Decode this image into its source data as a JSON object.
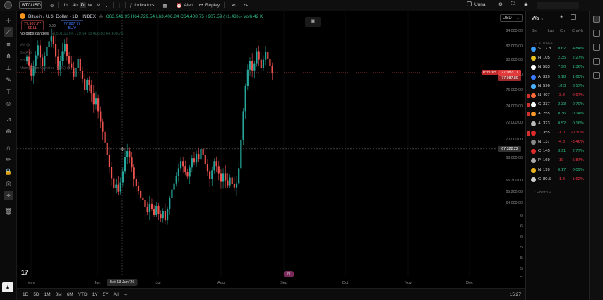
{
  "toolbar": {
    "symbol": "BTCUSD",
    "intervals": [
      "1h",
      "4h",
      "D",
      "W",
      "M"
    ],
    "active_interval": "D",
    "indicators_label": "Indicators",
    "alert_label": "Alert",
    "replay_label": "Replay",
    "layout_name": "Unna"
  },
  "legend": {
    "title": "Bitcoin / U.S. Dollar · 1D · INDEX",
    "ohlc": "O63,541.95 H64,729.54 L63,406.84 C64,408.75 +907.59 (+1.43%) Vol6.42 K",
    "sell_price": "77,987.77",
    "sell_label": "SELL",
    "mid_value": "0.00",
    "buy_price": "77,987.77",
    "buy_label": "BUY",
    "gaps_label": "No gaps candles",
    "gaps_values": "63,501.10 64,729.54 63,406.80 64,408.75",
    "ind_1": "Vol",
    "ind_2": "SMA",
    "ind_3": "BB",
    "ind_4": "Momentum Candles (1.00)"
  },
  "price_axis": {
    "currency": "USD",
    "ticks": [
      "84,000.00",
      "82,000.00",
      "80,000.00",
      "78,000.00",
      "76,000.00",
      "74,000.00",
      "72,000.00",
      "70,000.00",
      "68,000.00",
      "66,300.00",
      "65,200.00",
      "64,000.00",
      "6",
      "6",
      "6",
      "5",
      "5",
      "5",
      "5",
      "5"
    ],
    "current_price": "77,987.77",
    "current_sub": "77,987.89",
    "crosshair_price": "67,322.22",
    "symbol_tag": "BTCUSD"
  },
  "time_axis": {
    "ticks": [
      "May",
      "Jun",
      "Jul",
      "Aug",
      "Sep",
      "Oct",
      "Nov",
      "Dec"
    ],
    "hover_date": "Sat 13 Jun '26"
  },
  "ranges": [
    "1D",
    "5D",
    "1M",
    "3M",
    "6M",
    "YTD",
    "1Y",
    "5Y",
    "All"
  ],
  "clock": "15:27",
  "watchlist": {
    "title": "Wa",
    "columns": {
      "symbol": "Syr",
      "last": "Las",
      "change": "Ch",
      "change_pct": "Chg%"
    },
    "section_stocks": "STOCKS",
    "section_crypto": "CRYPTO",
    "rows": [
      {
        "sym": "S",
        "last": "17.8",
        "ch": "0.62",
        "pct": "4.84%",
        "dir": "up",
        "marker": false,
        "icon_color": "#3aa0ff"
      },
      {
        "sym": "H",
        "last": "105",
        "ch": "2.35",
        "pct": "2.27%",
        "dir": "up",
        "marker": false,
        "icon_color": "#e8c020"
      },
      {
        "sym": "N",
        "last": "583",
        "ch": "7.90",
        "pct": "1.36%",
        "dir": "up",
        "marker": false,
        "icon_color": "#ffffff"
      },
      {
        "sym": "A",
        "last": "329",
        "ch": "5.18",
        "pct": "1.60%",
        "dir": "up",
        "marker": false,
        "icon_color": "#3a7bff"
      },
      {
        "sym": "N",
        "last": "596",
        "ch": "18.3",
        "pct": "3.17%",
        "dir": "up",
        "marker": false,
        "icon_color": "#4ab0ff"
      },
      {
        "sym": "N",
        "last": "497",
        "ch": "-3.3",
        "pct": "-0.67%",
        "dir": "dn",
        "marker": true,
        "icon_color": "#ff6a3a"
      },
      {
        "sym": "G",
        "last": "337",
        "ch": "2.33",
        "pct": "0.70%",
        "dir": "up",
        "marker": true,
        "icon_color": "#ffffff"
      },
      {
        "sym": "A",
        "last": "255",
        "ch": "0.36",
        "pct": "0.14%",
        "dir": "up",
        "marker": true,
        "icon_color": "#ff9a2a"
      },
      {
        "sym": "A",
        "last": "323",
        "ch": "0.52",
        "pct": "0.16%",
        "dir": "up",
        "marker": false,
        "icon_color": "#bbbbbb"
      },
      {
        "sym": "T",
        "last": "355",
        "ch": "-1.0",
        "pct": "-0.30%",
        "dir": "dn",
        "marker": true,
        "icon_color": "#e02a2a"
      },
      {
        "sym": "N",
        "last": "137",
        "ch": "-4.8",
        "pct": "-3.46%",
        "dir": "dn",
        "marker": false,
        "icon_color": "#888888"
      },
      {
        "sym": "C",
        "last": "145",
        "ch": "3.91",
        "pct": "2.77%",
        "dir": "up",
        "marker": false,
        "icon_color": "#e02a2a"
      },
      {
        "sym": "P",
        "last": "169",
        "ch": "-10",
        "pct": "-5.87%",
        "dir": "dn",
        "marker": false,
        "icon_color": "#aaaaaa"
      },
      {
        "sym": "N",
        "last": "199",
        "ch": "0.17",
        "pct": "0.09%",
        "dir": "up",
        "marker": false,
        "icon_color": "#e8b020"
      },
      {
        "sym": "C",
        "last": "80.5",
        "ch": "-1.3",
        "pct": "-1.62%",
        "dir": "dn",
        "marker": false,
        "icon_color": "#cccccc"
      }
    ]
  },
  "chart_data": {
    "type": "candlestick",
    "y_range": [
      50000,
      85000
    ],
    "current_price": 77987.77,
    "crosshair_price": 67322.22,
    "close_series": [
      80200,
      79000,
      77600,
      78900,
      80400,
      81800,
      80100,
      78900,
      80300,
      81600,
      82400,
      83100,
      82000,
      80200,
      78400,
      79600,
      81000,
      82000,
      80300,
      79300,
      78700,
      77400,
      78600,
      79900,
      78200,
      77100,
      75600,
      77000,
      76200,
      75100,
      73500,
      74400,
      72600,
      71100,
      69700,
      68200,
      66500,
      64800,
      63200,
      61800,
      62300,
      61300,
      62600,
      64200,
      66200,
      67000,
      66100,
      64700,
      63100,
      62100,
      61400,
      60500,
      60100,
      59200,
      58400,
      59600,
      58900,
      58100,
      59300,
      58200,
      57600,
      58600,
      57300,
      58900,
      60400,
      61600,
      62500,
      63500,
      64600,
      65600,
      64900,
      64100,
      63400,
      64700,
      66000,
      65400,
      66600,
      65900,
      67300,
      66500,
      65200,
      64200,
      63100,
      64300,
      65600,
      64900,
      63900,
      62700,
      63900,
      62900,
      62200,
      63300,
      62400,
      61900,
      62500,
      64600,
      68600,
      72600,
      76100,
      78400,
      79600,
      78300,
      79300,
      81000,
      79800,
      78600,
      79800,
      80900,
      79900,
      78900,
      78000
    ]
  }
}
